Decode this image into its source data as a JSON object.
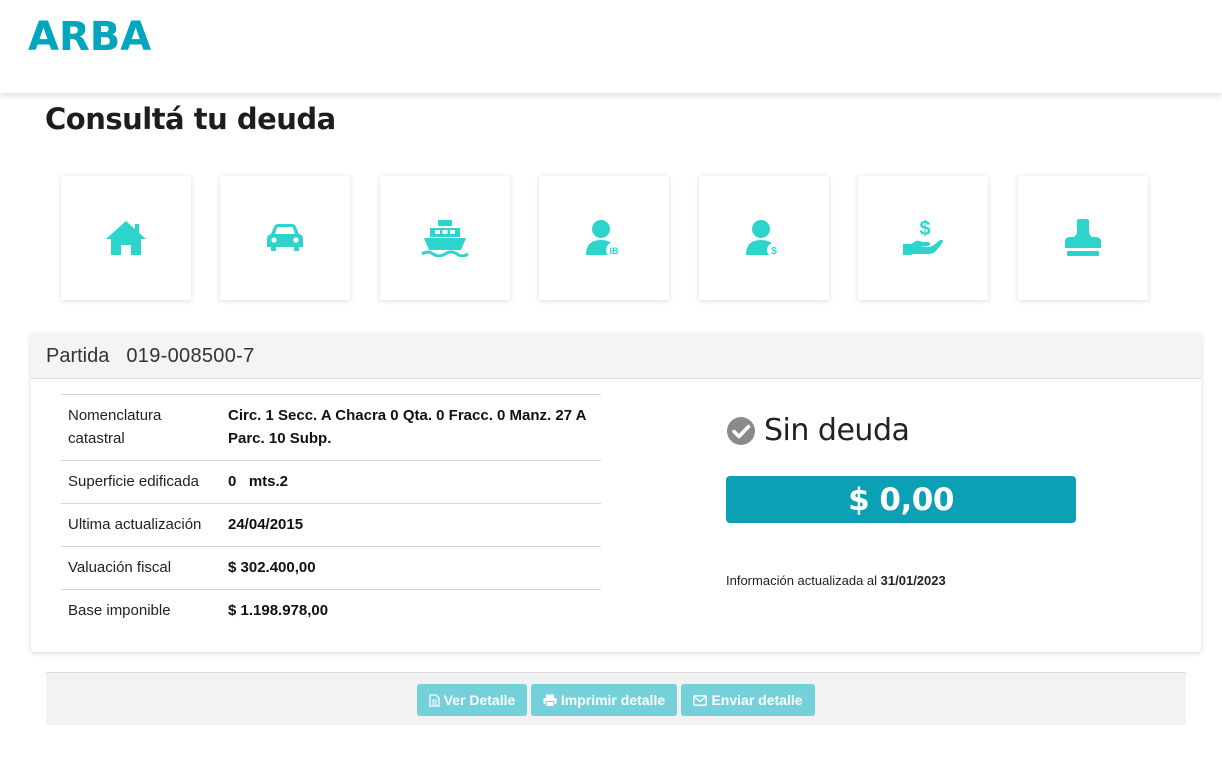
{
  "header": {
    "logo": "ARBA"
  },
  "page": {
    "title": "Consultá tu deuda"
  },
  "tiles": [
    {
      "icon": "house-icon"
    },
    {
      "icon": "car-icon"
    },
    {
      "icon": "boat-icon"
    },
    {
      "icon": "user-ib-icon",
      "badge": "IB"
    },
    {
      "icon": "user-dollar-icon",
      "badge": "$"
    },
    {
      "icon": "hand-dollar-icon",
      "badge": "$"
    },
    {
      "icon": "stamp-icon"
    }
  ],
  "colors": {
    "brand": "#00a6be",
    "icon": "#2dd4cc",
    "amount_bg": "#0ba0b4",
    "button_bg": "#74d1d9"
  },
  "card": {
    "label": "Partida",
    "value": "019-008500-7",
    "rows": [
      {
        "label": "Nomenclatura catastral",
        "value": "Circ. 1 Secc. A Chacra 0 Qta. 0 Fracc. 0 Manz. 27 A Parc. 10 Subp."
      },
      {
        "label": "Superficie edificada",
        "value": "0   mts.2"
      },
      {
        "label": "Ultima actualización",
        "value": "24/04/2015"
      },
      {
        "label": "Valuación fiscal",
        "value": "$ 302.400,00"
      },
      {
        "label": "Base imponible",
        "value": "$ 1.198.978,00"
      }
    ],
    "status": {
      "icon": "check-circle-icon",
      "text": "Sin deuda"
    },
    "amount": "$ 0,00",
    "updated_prefix": "Información actualizada al",
    "updated_date": "31/01/2023"
  },
  "actions": [
    {
      "icon": "file-icon",
      "label": "Ver Detalle"
    },
    {
      "icon": "print-icon",
      "label": "Imprimir detalle"
    },
    {
      "icon": "envelope-icon",
      "label": "Enviar detalle"
    }
  ]
}
